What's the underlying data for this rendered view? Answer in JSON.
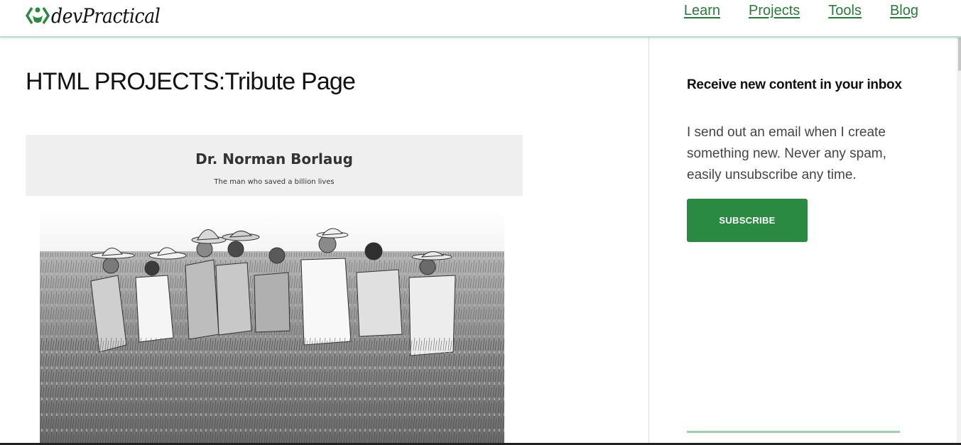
{
  "header": {
    "logo_text": "devPractical",
    "nav": [
      {
        "label": "Learn"
      },
      {
        "label": "Projects"
      },
      {
        "label": "Tools"
      },
      {
        "label": "Blog"
      }
    ]
  },
  "main": {
    "title": "HTML PROJECTS:Tribute Page",
    "tribute": {
      "name": "Dr. Norman Borlaug",
      "subtitle": "The man who saved a billion lives"
    }
  },
  "sidebar": {
    "heading": "Receive new content in your inbox",
    "description": "I send out an email when I create something new. Never any spam, easily unsubscribe any time.",
    "subscribe_label": "SUBSCRIBE"
  },
  "colors": {
    "brand_green": "#2b8a42",
    "link_green": "#2a7a3a",
    "header_rule": "#b8dcc0"
  }
}
